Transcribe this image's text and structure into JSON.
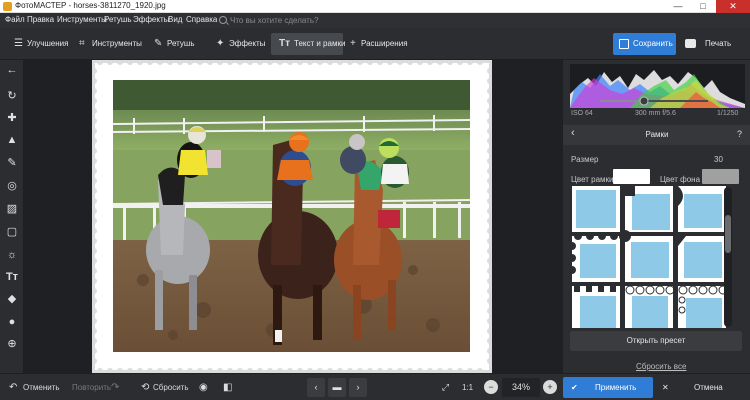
{
  "window": {
    "title": "ФотоМАСТЕР - horses-3811270_1920.jpg",
    "minimize": "—",
    "maximize": "□",
    "close": "✕"
  },
  "menu": {
    "items": [
      "Файл",
      "Правка",
      "Инструменты",
      "Ретушь",
      "Эффекты",
      "Вид",
      "Справка"
    ],
    "search_placeholder": "Что вы хотите сделать?"
  },
  "toolbar": {
    "tabs": [
      {
        "label": "Улучшения",
        "icon": "sliders-icon"
      },
      {
        "label": "Инструменты",
        "icon": "crop-icon"
      },
      {
        "label": "Ретушь",
        "icon": "brush-icon"
      },
      {
        "label": "Эффекты",
        "icon": "magic-wand-icon"
      },
      {
        "label": "Текст и рамки",
        "icon": "text-frame-icon",
        "active": true
      },
      {
        "label": "Расширения",
        "icon": "plus-icon"
      }
    ],
    "save_label": "Сохранить",
    "print_label": "Печать"
  },
  "left_tools": [
    "back-arrow-icon",
    "rotate-icon",
    "healing-patch-icon",
    "stamp-icon",
    "brush-icon",
    "radial-filter-icon",
    "gradient-icon",
    "vignette-icon",
    "light-icon",
    "text-icon",
    "fill-icon",
    "lasso-icon",
    "target-icon"
  ],
  "histogram_info": {
    "iso": "ISO 64",
    "lens": "300 mm f/5.6",
    "shutter": "1/1250"
  },
  "panel": {
    "title": "Рамки",
    "back": "‹",
    "help": "?",
    "size_label": "Размер",
    "size_value": "30",
    "size_level": 0.15,
    "frame_color_label": "Цвет рамки",
    "bg_color_label": "Цвет фона",
    "frame_color": "#ffffff",
    "bg_color": "#a0a0a0",
    "open_preset": "Открыть пресет",
    "reset_all": "Сбросить все"
  },
  "bottom": {
    "undo": "Отменить",
    "redo": "Повторить",
    "reset": "Сбросить",
    "ratio": "1:1",
    "zoom": "34%",
    "apply": "Применить",
    "cancel": "Отмена"
  },
  "colors": {
    "accent": "#2f7dd6",
    "thumb_blue": "#8ecae8"
  }
}
